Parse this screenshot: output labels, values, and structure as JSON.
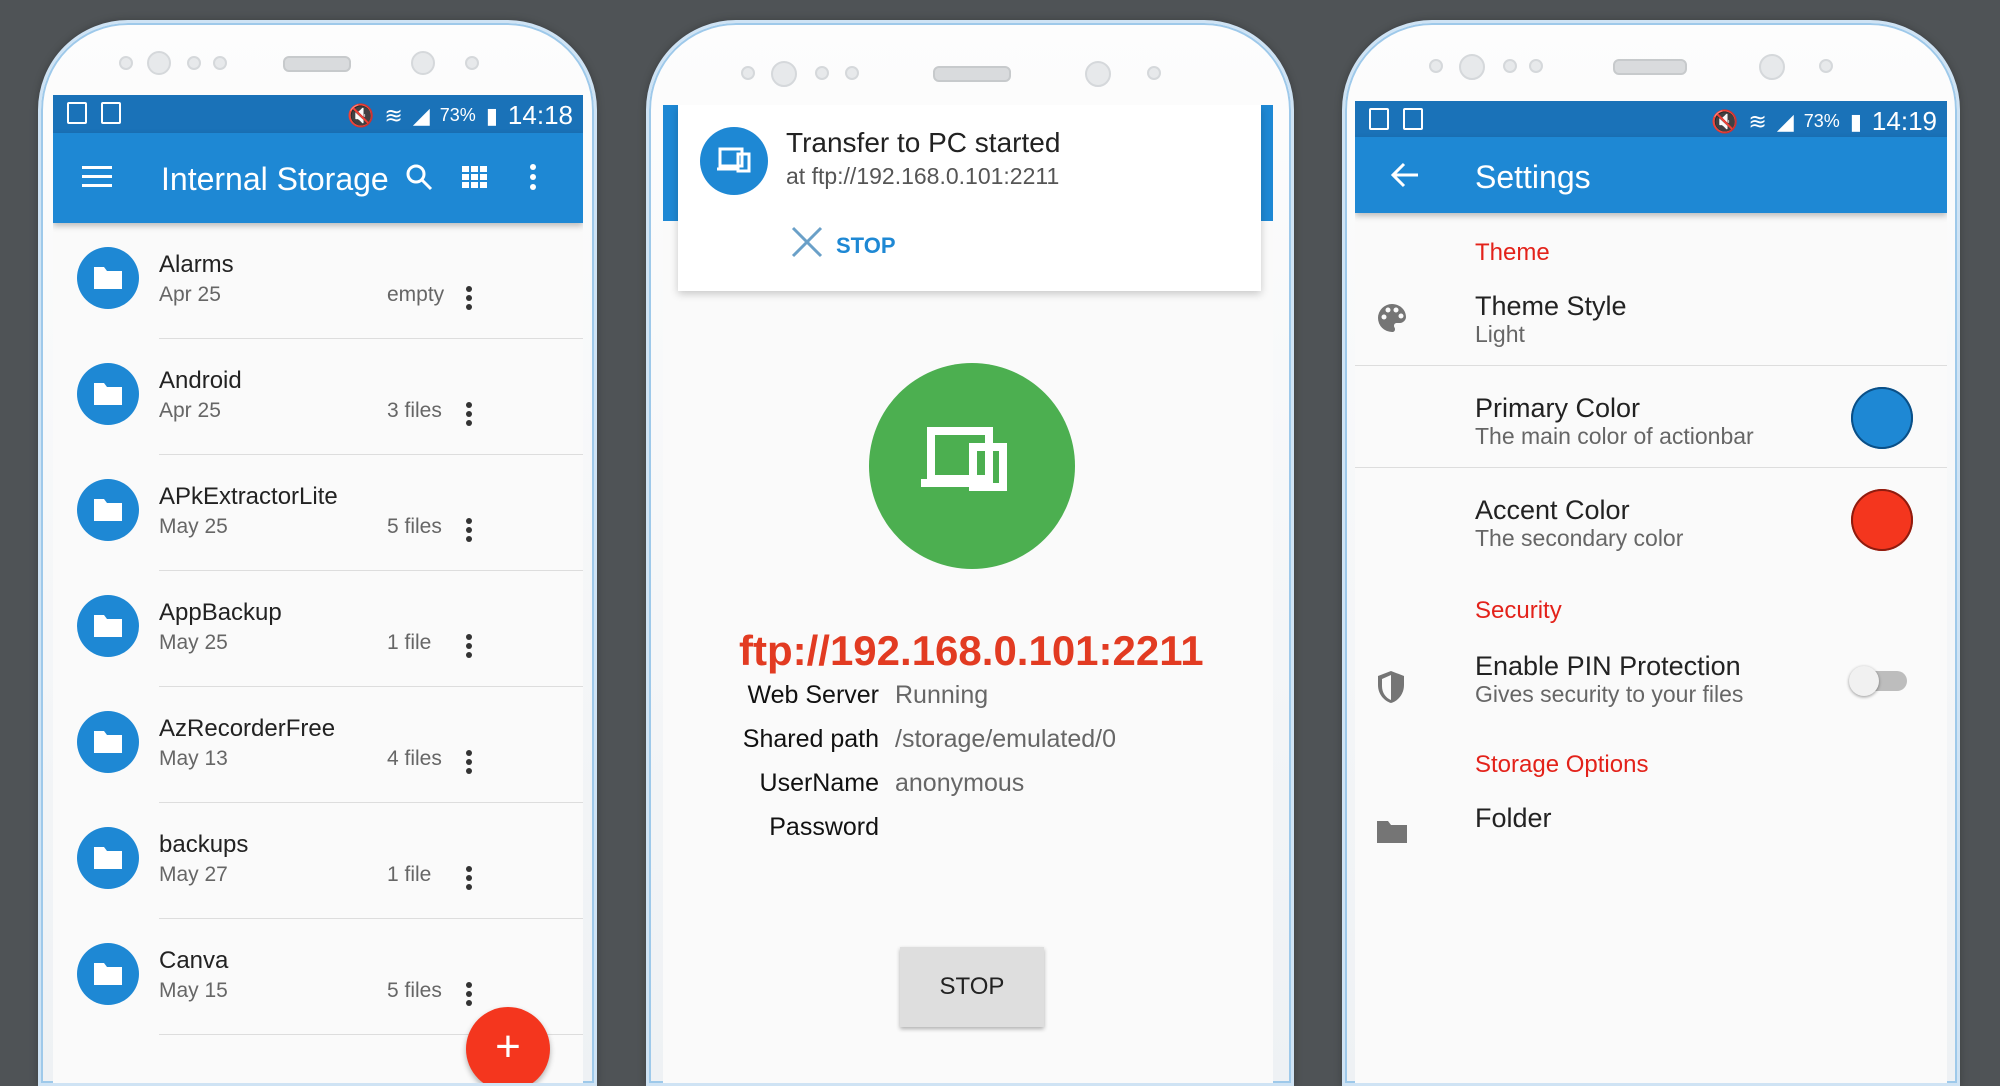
{
  "colors": {
    "primary": "#1e88d4",
    "accent": "#f4361e",
    "status": "#1a72b8",
    "ftp_green": "#4caf50",
    "section": "#e3221a"
  },
  "phone1": {
    "status": {
      "battery": "73%",
      "time": "14:18"
    },
    "appbar": {
      "title": "Internal Storage",
      "menu_icon": "menu-icon",
      "search_icon": "search-icon",
      "grid_icon": "grid-view-icon",
      "more_icon": "more-vert-icon"
    },
    "files": [
      {
        "name": "Alarms",
        "date": "Apr 25",
        "count": "empty"
      },
      {
        "name": "Android",
        "date": "Apr 25",
        "count": "3 files"
      },
      {
        "name": "APkExtractorLite",
        "date": "May 25",
        "count": "5 files"
      },
      {
        "name": "AppBackup",
        "date": "May 25",
        "count": "1 file"
      },
      {
        "name": "AzRecorderFree",
        "date": "May 13",
        "count": "4 files"
      },
      {
        "name": "backups",
        "date": "May 27",
        "count": "1 file"
      },
      {
        "name": "Canva",
        "date": "May 15",
        "count": "5 files"
      }
    ],
    "fab": "+"
  },
  "phone2": {
    "notification": {
      "title": "Transfer to PC started",
      "subtitle": "at ftp://192.168.0.101:2211",
      "stop": "STOP"
    },
    "url": "ftp://192.168.0.101:2211",
    "info": [
      {
        "key": "Web Server",
        "value": "Running"
      },
      {
        "key": "Shared path",
        "value": "/storage/emulated/0"
      },
      {
        "key": "UserName",
        "value": "anonymous"
      },
      {
        "key": "Password",
        "value": ""
      }
    ],
    "stop_button": "STOP"
  },
  "phone3": {
    "status": {
      "battery": "73%",
      "time": "14:19"
    },
    "appbar": {
      "title": "Settings",
      "back_icon": "arrow-back-icon"
    },
    "sections": {
      "theme": "Theme",
      "security": "Security",
      "storage": "Storage Options"
    },
    "prefs": {
      "theme_style": {
        "title": "Theme Style",
        "summary": "Light"
      },
      "primary": {
        "title": "Primary Color",
        "summary": "The main color of actionbar",
        "color": "#1e88d4"
      },
      "accent": {
        "title": "Accent Color",
        "summary": "The secondary color",
        "color": "#f4361e"
      },
      "pin": {
        "title": "Enable PIN Protection",
        "summary": "Gives security to your files",
        "enabled": false
      },
      "folder": {
        "title": "Folder"
      }
    }
  }
}
